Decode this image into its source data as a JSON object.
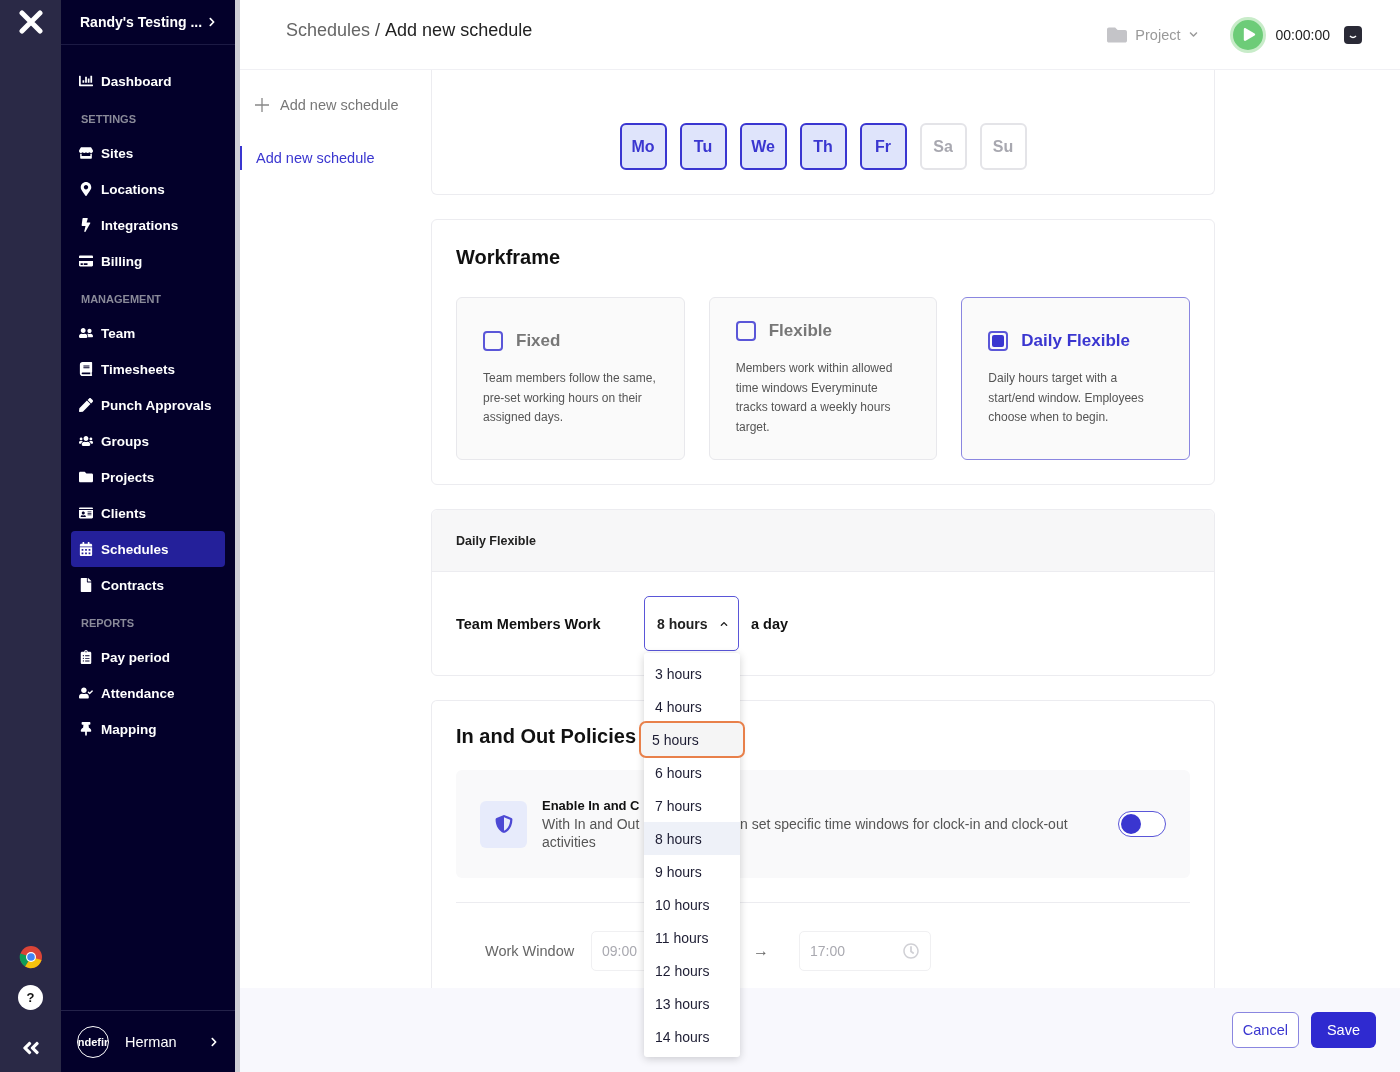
{
  "rail": {
    "help": "?"
  },
  "sidebar": {
    "org": "Randy's Testing ...",
    "sections": [
      {
        "items": [
          {
            "label": "Dashboard",
            "selected": false
          }
        ]
      },
      {
        "heading": "SETTINGS",
        "items": [
          {
            "label": "Sites",
            "selected": false
          },
          {
            "label": "Locations",
            "selected": false
          },
          {
            "label": "Integrations",
            "selected": false
          },
          {
            "label": "Billing",
            "selected": false
          }
        ]
      },
      {
        "heading": "MANAGEMENT",
        "items": [
          {
            "label": "Team",
            "selected": false
          },
          {
            "label": "Timesheets",
            "selected": false
          },
          {
            "label": "Punch Approvals",
            "selected": false
          },
          {
            "label": "Groups",
            "selected": false
          },
          {
            "label": "Projects",
            "selected": false
          },
          {
            "label": "Clients",
            "selected": false
          },
          {
            "label": "Schedules",
            "selected": true
          },
          {
            "label": "Contracts",
            "selected": false
          }
        ]
      },
      {
        "heading": "REPORTS",
        "items": [
          {
            "label": "Pay period",
            "selected": false
          },
          {
            "label": "Attendance",
            "selected": false
          },
          {
            "label": "Mapping",
            "selected": false
          }
        ]
      }
    ],
    "user": {
      "avatar_text": "ndefir",
      "name": "Herman"
    }
  },
  "topbar": {
    "breadcrumb": {
      "parent": "Schedules",
      "separator": "/",
      "current": "Add new schedule"
    },
    "project": "Project",
    "timer": "00:00:00"
  },
  "subnav": {
    "add_button": "Add new schedule",
    "items": [
      {
        "label": "Add new schedule",
        "selected": true
      }
    ]
  },
  "working_days": {
    "days": [
      {
        "label": "Mo",
        "selected": true
      },
      {
        "label": "Tu",
        "selected": true
      },
      {
        "label": "We",
        "selected": true
      },
      {
        "label": "Th",
        "selected": true
      },
      {
        "label": "Fr",
        "selected": true
      },
      {
        "label": "Sa",
        "selected": false
      },
      {
        "label": "Su",
        "selected": false
      }
    ]
  },
  "workframe": {
    "title": "Workframe",
    "options": [
      {
        "title": "Fixed",
        "description": "Team members follow the same, pre-set working hours on their assigned days.",
        "selected": false
      },
      {
        "title": "Flexible",
        "description": "Members work within allowed time windows Everyminute tracks toward a weekly hours target.",
        "selected": false
      },
      {
        "title": "Daily Flexible",
        "description": "Daily hours target with a start/end window. Employees choose when to begin.",
        "selected": true
      }
    ]
  },
  "daily_flexible": {
    "header": "Daily Flexible",
    "label": "Team Members Work",
    "suffix": "a day",
    "select": {
      "value": "8 hours",
      "expanded": true,
      "options": [
        {
          "label": "3 hours",
          "selected": false,
          "hovered": false
        },
        {
          "label": "4 hours",
          "selected": false,
          "hovered": false
        },
        {
          "label": "5 hours",
          "selected": false,
          "hovered": true
        },
        {
          "label": "6 hours",
          "selected": false,
          "hovered": false
        },
        {
          "label": "7 hours",
          "selected": false,
          "hovered": false
        },
        {
          "label": "8 hours",
          "selected": true,
          "hovered": false
        },
        {
          "label": "9 hours",
          "selected": false,
          "hovered": false
        },
        {
          "label": "10 hours",
          "selected": false,
          "hovered": false
        },
        {
          "label": "11 hours",
          "selected": false,
          "hovered": false
        },
        {
          "label": "12 hours",
          "selected": false,
          "hovered": false
        },
        {
          "label": "13 hours",
          "selected": false,
          "hovered": false
        },
        {
          "label": "14 hours",
          "selected": false,
          "hovered": false
        }
      ]
    }
  },
  "policies": {
    "title": "In and Out Policies",
    "toggle_row": {
      "title": "Enable In and C",
      "description_start": "With In and Out",
      "description_end": "n set specific time windows for clock-in and clock-out",
      "description_line2": "activities",
      "on": false
    },
    "work_window": {
      "label": "Work Window",
      "start": {
        "placeholder": "09:00"
      },
      "arrow": "→",
      "end": {
        "placeholder": "17:00"
      }
    }
  },
  "footer": {
    "cancel": "Cancel",
    "save": "Save"
  }
}
